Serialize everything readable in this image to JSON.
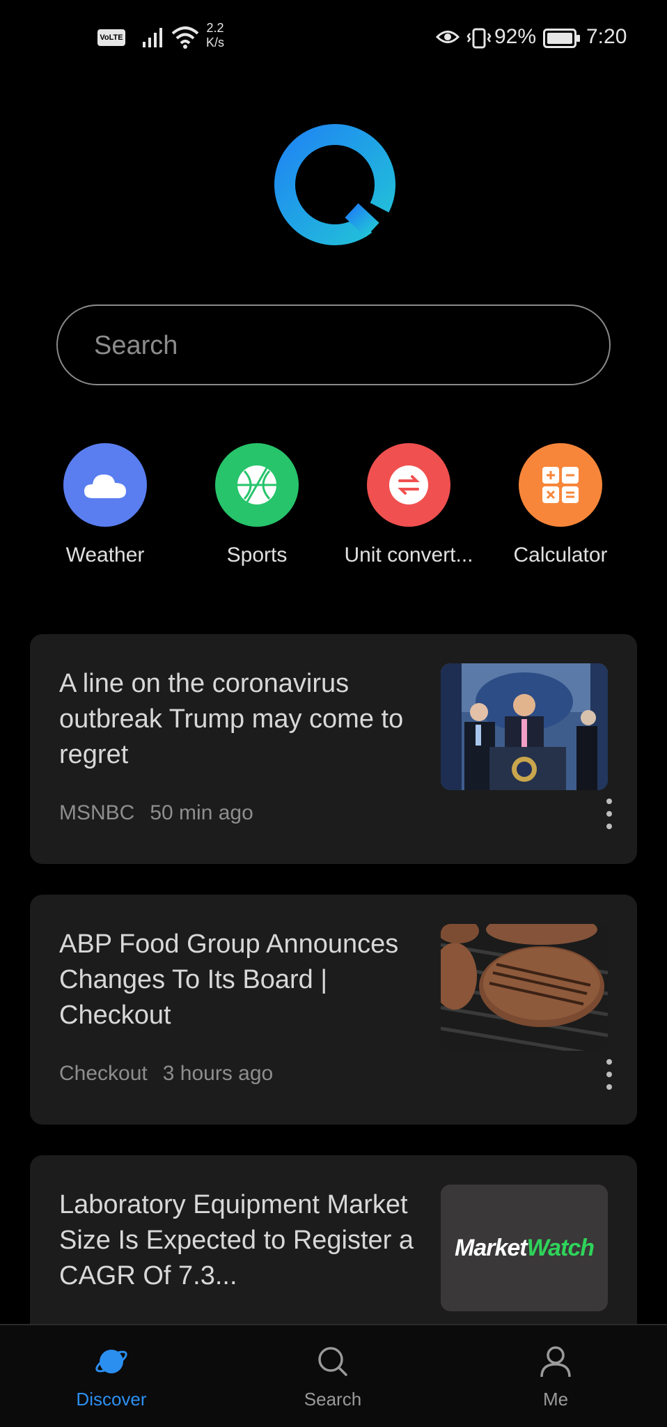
{
  "status_bar": {
    "volte": "VoLTE",
    "speed_value": "2.2",
    "speed_unit": "K/s",
    "battery_percent": "92%",
    "time": "7:20"
  },
  "search": {
    "placeholder": "Search"
  },
  "shortcuts": [
    {
      "label": "Weather",
      "icon": "cloud-icon",
      "color": "#5a7ef0"
    },
    {
      "label": "Sports",
      "icon": "basketball-icon",
      "color": "#27c46b"
    },
    {
      "label": "Unit convert...",
      "icon": "swap-arrows-icon",
      "color": "#f0504f"
    },
    {
      "label": "Calculator",
      "icon": "calculator-icon",
      "color": "#f7863a"
    }
  ],
  "news": [
    {
      "title": "A line on the coronavirus outbreak Trump may come to regret",
      "source": "MSNBC",
      "time": "50 min ago"
    },
    {
      "title": "ABP Food Group Announces Changes To Its Board | Checkout",
      "source": "Checkout",
      "time": "3 hours ago"
    },
    {
      "title": "Laboratory Equipment Market Size Is Expected to Register a CAGR Of 7.3...",
      "thumb_logo_part1": "Market",
      "thumb_logo_part2": "Watch"
    }
  ],
  "bottom_nav": [
    {
      "label": "Discover",
      "icon": "discover-planet-icon",
      "active": true
    },
    {
      "label": "Search",
      "icon": "search-icon",
      "active": false
    },
    {
      "label": "Me",
      "icon": "person-icon",
      "active": false
    }
  ],
  "colors": {
    "accent": "#2b8ff0",
    "background": "#000000",
    "card": "#1c1c1c"
  }
}
